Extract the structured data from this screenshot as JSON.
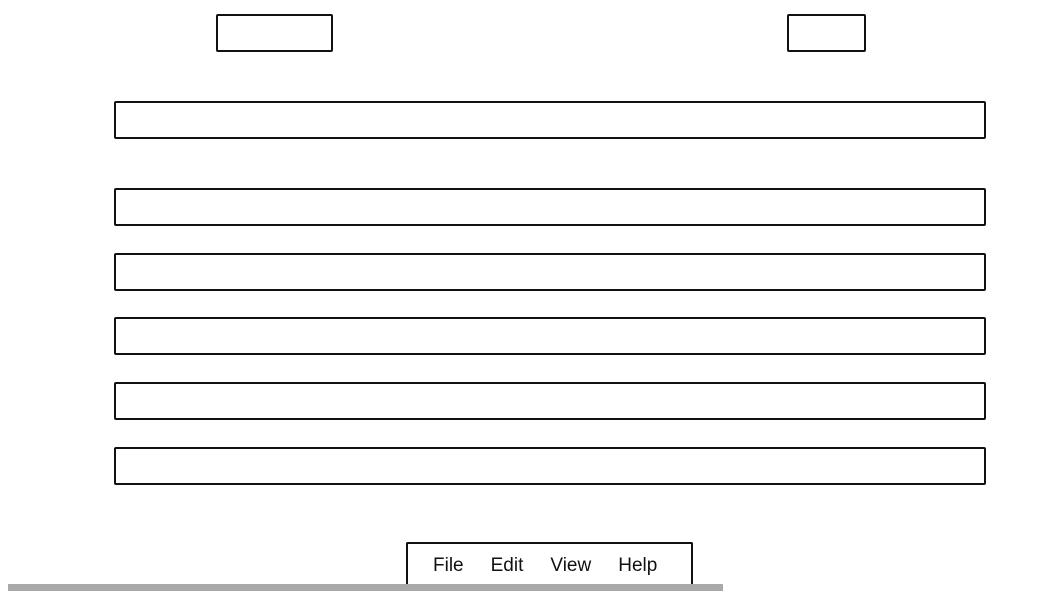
{
  "menubar": {
    "items": [
      {
        "label": "File"
      },
      {
        "label": "Edit"
      },
      {
        "label": "View"
      },
      {
        "label": "Help"
      }
    ]
  },
  "colors": {
    "stroke": "#111111",
    "background": "#ffffff",
    "scrollbar_thumb": "#a9a9a9"
  }
}
